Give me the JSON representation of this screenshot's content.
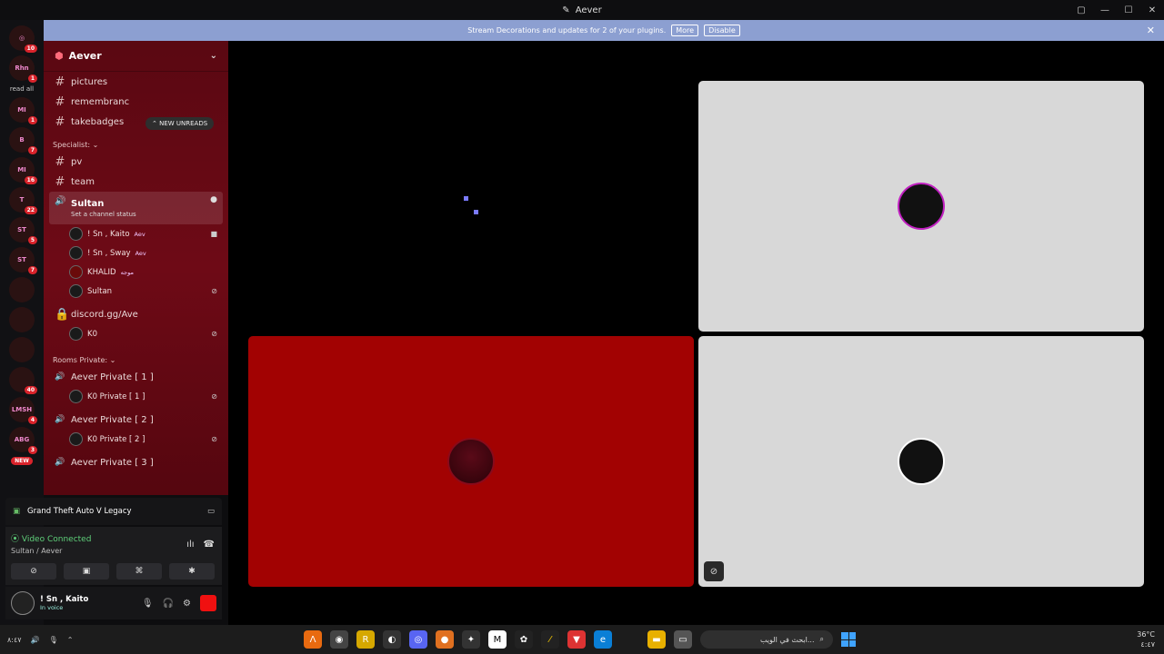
{
  "window": {
    "title": "Aever",
    "controls": [
      "▢",
      "—",
      "☐",
      "✕"
    ]
  },
  "notice": {
    "text": "Stream Decorations and updates for 2 of your plugins.",
    "more_label": "More",
    "dismiss_label": "Disable",
    "close": "✕"
  },
  "rail": {
    "home_badge": "10",
    "read_all": "read all",
    "new_label": "NEW",
    "servers": [
      {
        "label": "Rhn",
        "badge": "1"
      },
      {
        "label": "MI",
        "badge": "1"
      },
      {
        "label": "B",
        "badge": "7"
      },
      {
        "label": "MI",
        "badge": "16"
      },
      {
        "label": "T",
        "badge": "22"
      },
      {
        "label": "ST",
        "badge": "5"
      },
      {
        "label": "ST",
        "badge": "7"
      },
      {
        "label": "",
        "badge": ""
      },
      {
        "label": "",
        "badge": ""
      },
      {
        "label": "",
        "badge": ""
      },
      {
        "label": "",
        "badge": "40"
      },
      {
        "label": "LMSH",
        "badge": "4"
      },
      {
        "label": "ABG",
        "badge": "3"
      }
    ]
  },
  "sidebar": {
    "server_name": "Aever",
    "new_unreads": "NEW UNREADS",
    "channels_top": [
      "pictures",
      "remembranc",
      "takebadges"
    ],
    "category_specialist": "Specialist:",
    "channels_mid": [
      "pv",
      "team"
    ],
    "active_channel": {
      "name": "Sultan",
      "status": "Set a channel status"
    },
    "voice_users": [
      {
        "name": "! Sn , Kaito",
        "tag": "Aev"
      },
      {
        "name": "! Sn , Sway",
        "tag": "Aev"
      },
      {
        "name": "KHALID",
        "tag": "موجه"
      },
      {
        "name": "Sultan",
        "tag": ""
      }
    ],
    "locked_channel": "discord.gg/Ave",
    "locked_user": "K0",
    "category_rooms": "Rooms Private:",
    "private_rooms": [
      {
        "name": "Aever Private [ 1 ]",
        "user": "K0 Private [ 1 ]"
      },
      {
        "name": "Aever Private [ 2 ]",
        "user": "K0 Private [ 2 ]"
      },
      {
        "name": "Aever Private [ 3 ]",
        "user": ""
      }
    ]
  },
  "game": {
    "name": "Grand Theft Auto V Legacy"
  },
  "voice": {
    "status": "Video Connected",
    "location": "Sultan / Aever"
  },
  "me": {
    "name": "! Sn , Kaito",
    "status": "In voice"
  },
  "taskbar": {
    "left_text": "٨:٤٧",
    "search_placeholder": "ابحث في الويب...",
    "temp": "36°C",
    "time": "٤:٤٧"
  }
}
